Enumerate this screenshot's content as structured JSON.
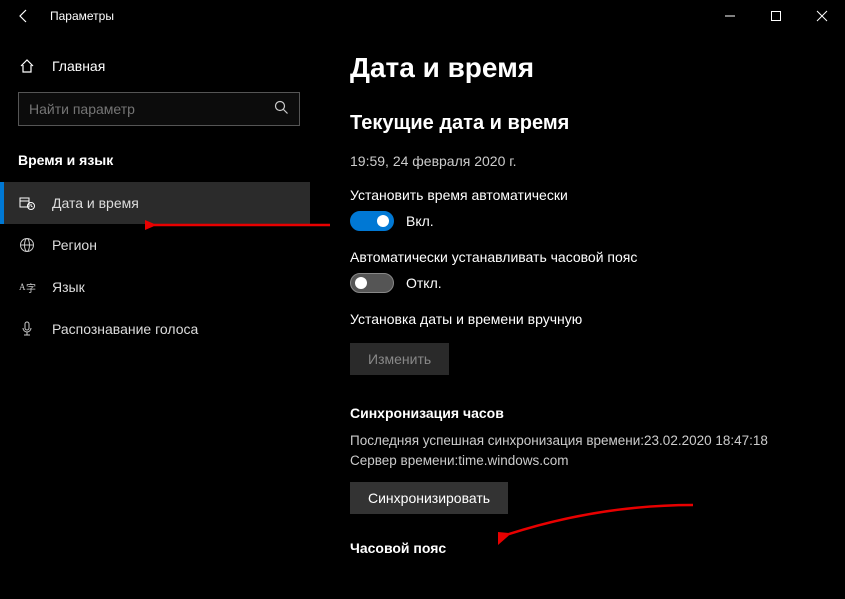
{
  "window": {
    "title": "Параметры"
  },
  "sidebar": {
    "home_label": "Главная",
    "search_placeholder": "Найти параметр",
    "category_label": "Время и язык",
    "items": [
      {
        "label": "Дата и время",
        "icon": "clock-calendar-icon"
      },
      {
        "label": "Регион",
        "icon": "globe-icon"
      },
      {
        "label": "Язык",
        "icon": "language-icon"
      },
      {
        "label": "Распознавание голоса",
        "icon": "microphone-icon"
      }
    ]
  },
  "content": {
    "heading": "Дата и время",
    "current_title": "Текущие дата и время",
    "current_value": "19:59, 24 февраля 2020 г.",
    "auto_time_label": "Установить время автоматически",
    "auto_time_state": "Вкл.",
    "auto_tz_label": "Автоматически устанавливать часовой пояс",
    "auto_tz_state": "Откл.",
    "manual_label": "Установка даты и времени вручную",
    "change_btn": "Изменить",
    "sync_title": "Синхронизация часов",
    "sync_last": "Последняя успешная синхронизация времени:23.02.2020 18:47:18",
    "sync_server": "Сервер времени:time.windows.com",
    "sync_btn": "Синхронизировать",
    "tz_title": "Часовой пояс"
  }
}
